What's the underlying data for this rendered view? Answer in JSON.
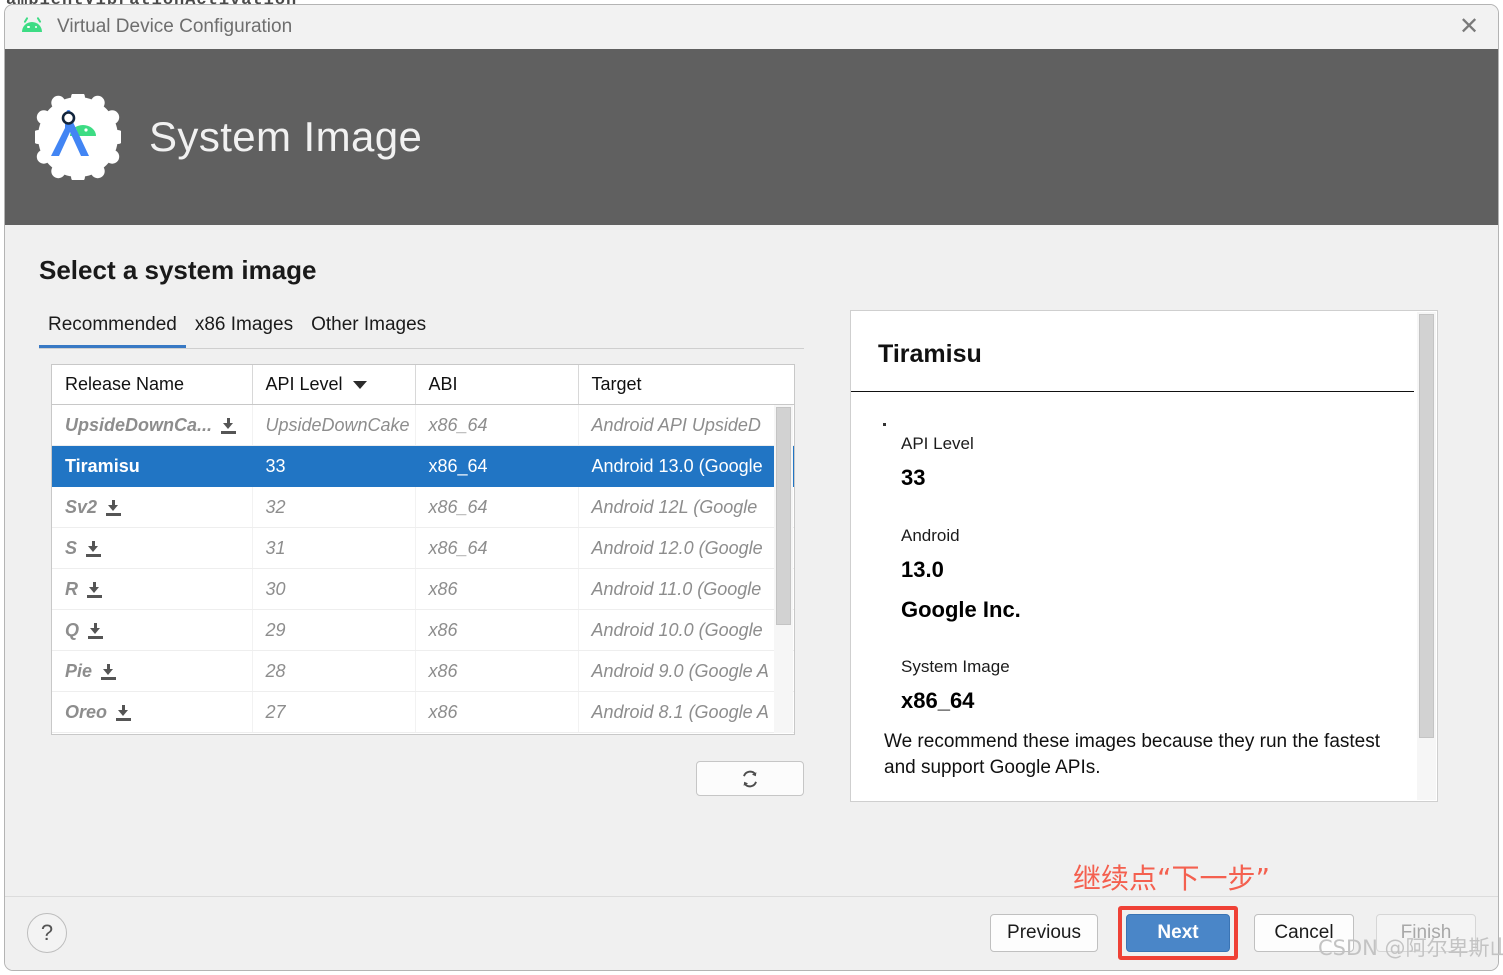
{
  "background": {
    "editor_line": "ambientVibrationActivation"
  },
  "titlebar": {
    "title": "Virtual Device Configuration",
    "app_icon": "android-robot-icon",
    "close_label": "✕"
  },
  "header": {
    "title": "System Image",
    "logo": "android-studio-logo",
    "background_color": "#606060"
  },
  "main": {
    "section_title": "Select a system image",
    "tabs": [
      {
        "label": "Recommended",
        "active": true
      },
      {
        "label": "x86 Images",
        "active": false
      },
      {
        "label": "Other Images",
        "active": false
      }
    ],
    "table": {
      "columns": [
        {
          "label": "Release Name",
          "sorted": false
        },
        {
          "label": "API Level",
          "sorted": true,
          "sort_icon": "chevron-down-icon"
        },
        {
          "label": "ABI",
          "sorted": false
        },
        {
          "label": "Target",
          "sorted": false
        }
      ],
      "rows": [
        {
          "release_name": "UpsideDownCa...",
          "api_level": "UpsideDownCake",
          "abi": "x86_64",
          "target": "Android API UpsideD",
          "downloadable": true,
          "selected": false
        },
        {
          "release_name": "Tiramisu",
          "api_level": "33",
          "abi": "x86_64",
          "target": "Android 13.0 (Google",
          "downloadable": false,
          "selected": true
        },
        {
          "release_name": "Sv2",
          "api_level": "32",
          "abi": "x86_64",
          "target": "Android 12L (Google ",
          "downloadable": true,
          "selected": false
        },
        {
          "release_name": "S",
          "api_level": "31",
          "abi": "x86_64",
          "target": "Android 12.0 (Google",
          "downloadable": true,
          "selected": false
        },
        {
          "release_name": "R",
          "api_level": "30",
          "abi": "x86",
          "target": "Android 11.0 (Google",
          "downloadable": true,
          "selected": false
        },
        {
          "release_name": "Q",
          "api_level": "29",
          "abi": "x86",
          "target": "Android 10.0 (Google",
          "downloadable": true,
          "selected": false
        },
        {
          "release_name": "Pie",
          "api_level": "28",
          "abi": "x86",
          "target": "Android 9.0 (Google A",
          "downloadable": true,
          "selected": false
        },
        {
          "release_name": "Oreo",
          "api_level": "27",
          "abi": "x86",
          "target": "Android 8.1 (Google A",
          "downloadable": true,
          "selected": false
        }
      ]
    },
    "refresh_button": {
      "icon": "refresh-icon",
      "label": ""
    },
    "details": {
      "title": "Tiramisu",
      "fields": [
        {
          "label": "API Level",
          "value": "33"
        },
        {
          "label": "Android",
          "value": "13.0"
        },
        {
          "label": "",
          "value": "Google Inc."
        },
        {
          "label": "System Image",
          "value": "x86_64"
        }
      ],
      "note": "We recommend these images because they run the fastest and support Google APIs."
    }
  },
  "annotation": {
    "text": "继续点“下一步”",
    "color": "#f4604f"
  },
  "footer": {
    "help_label": "?",
    "buttons": [
      {
        "id": "previous",
        "label": "Previous",
        "style": "normal",
        "highlighted": false
      },
      {
        "id": "next",
        "label": "Next",
        "style": "primary",
        "highlighted": true
      },
      {
        "id": "cancel",
        "label": "Cancel",
        "style": "normal",
        "highlighted": false
      },
      {
        "id": "finish",
        "label": "Finish",
        "style": "disabled",
        "highlighted": false
      }
    ]
  },
  "watermark": {
    "text": "CSDN @阿尔卑斯山林"
  }
}
